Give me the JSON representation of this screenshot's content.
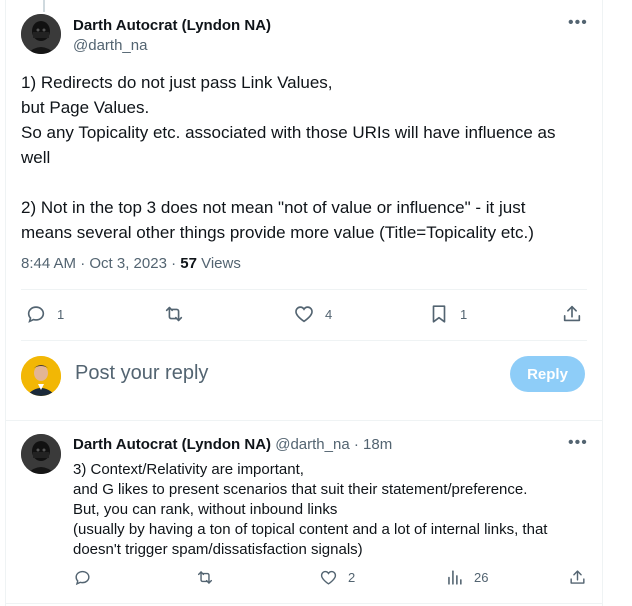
{
  "main_tweet": {
    "author_name": "Darth Autocrat (Lyndon NA)",
    "author_handle": "@darth_na",
    "text_lines": [
      "1) Redirects do not just pass Link Values,",
      "but Page Values.",
      "So any Topicality etc. associated with those URIs will have influence as",
      "well",
      "",
      "2) Not in the top 3 does not mean \"not of value or influence\" - it just",
      "means several other things provide more value (Title=Topicality etc.)"
    ],
    "time": "8:44 AM · Oct 3, 2023 ·",
    "views_count": "57",
    "views_label": "Views",
    "replies": "1",
    "likes": "4",
    "bookmarks": "1",
    "more_icon": "more-dots-icon"
  },
  "reply_composer": {
    "placeholder": "Post your reply",
    "button_label": "Reply",
    "button_color": "#8ecdf8"
  },
  "reply_tweet": {
    "author_name": "Darth Autocrat (Lyndon NA)",
    "author_handle": "@darth_na",
    "separator": "·",
    "time": "18m",
    "text_lines": [
      "3) Context/Relativity are important,",
      "and G likes to present scenarios that suit their statement/preference.",
      "But, you can rank, without inbound links",
      "(usually by having a ton of topical content and a lot of internal links, that",
      "doesn't trigger spam/dissatisfaction signals)"
    ],
    "likes": "2",
    "views": "26"
  },
  "colors": {
    "text": "#0f1419",
    "secondary": "#536471",
    "border": "#eff3f4"
  }
}
